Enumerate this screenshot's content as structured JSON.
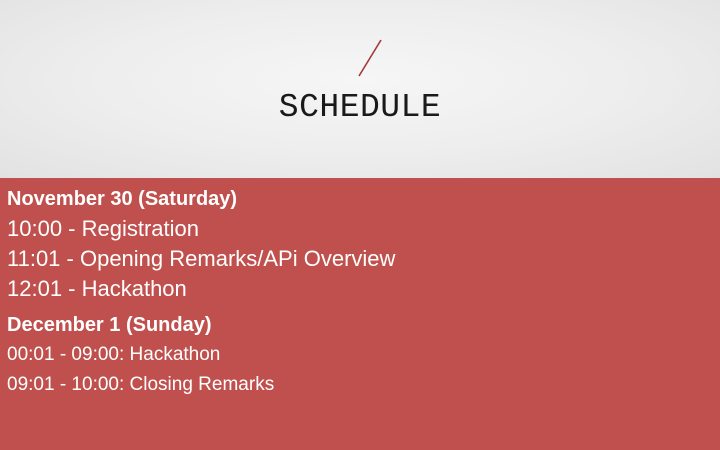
{
  "slide": {
    "title": "SCHEDULE",
    "accent_color": "#c0504d",
    "header_bg": "#ececec",
    "decoration_icon": "slash-divider"
  },
  "schedule": {
    "day1": {
      "heading": "November 30 (Saturday)",
      "items": [
        "10:00 - Registration",
        "11:01 - Opening Remarks/APi Overview",
        "12:01 - Hackathon"
      ]
    },
    "day2": {
      "heading": "December 1 (Sunday)",
      "items": [
        "00:01 - 09:00: Hackathon",
        "09:01 - 10:00: Closing Remarks"
      ]
    }
  }
}
